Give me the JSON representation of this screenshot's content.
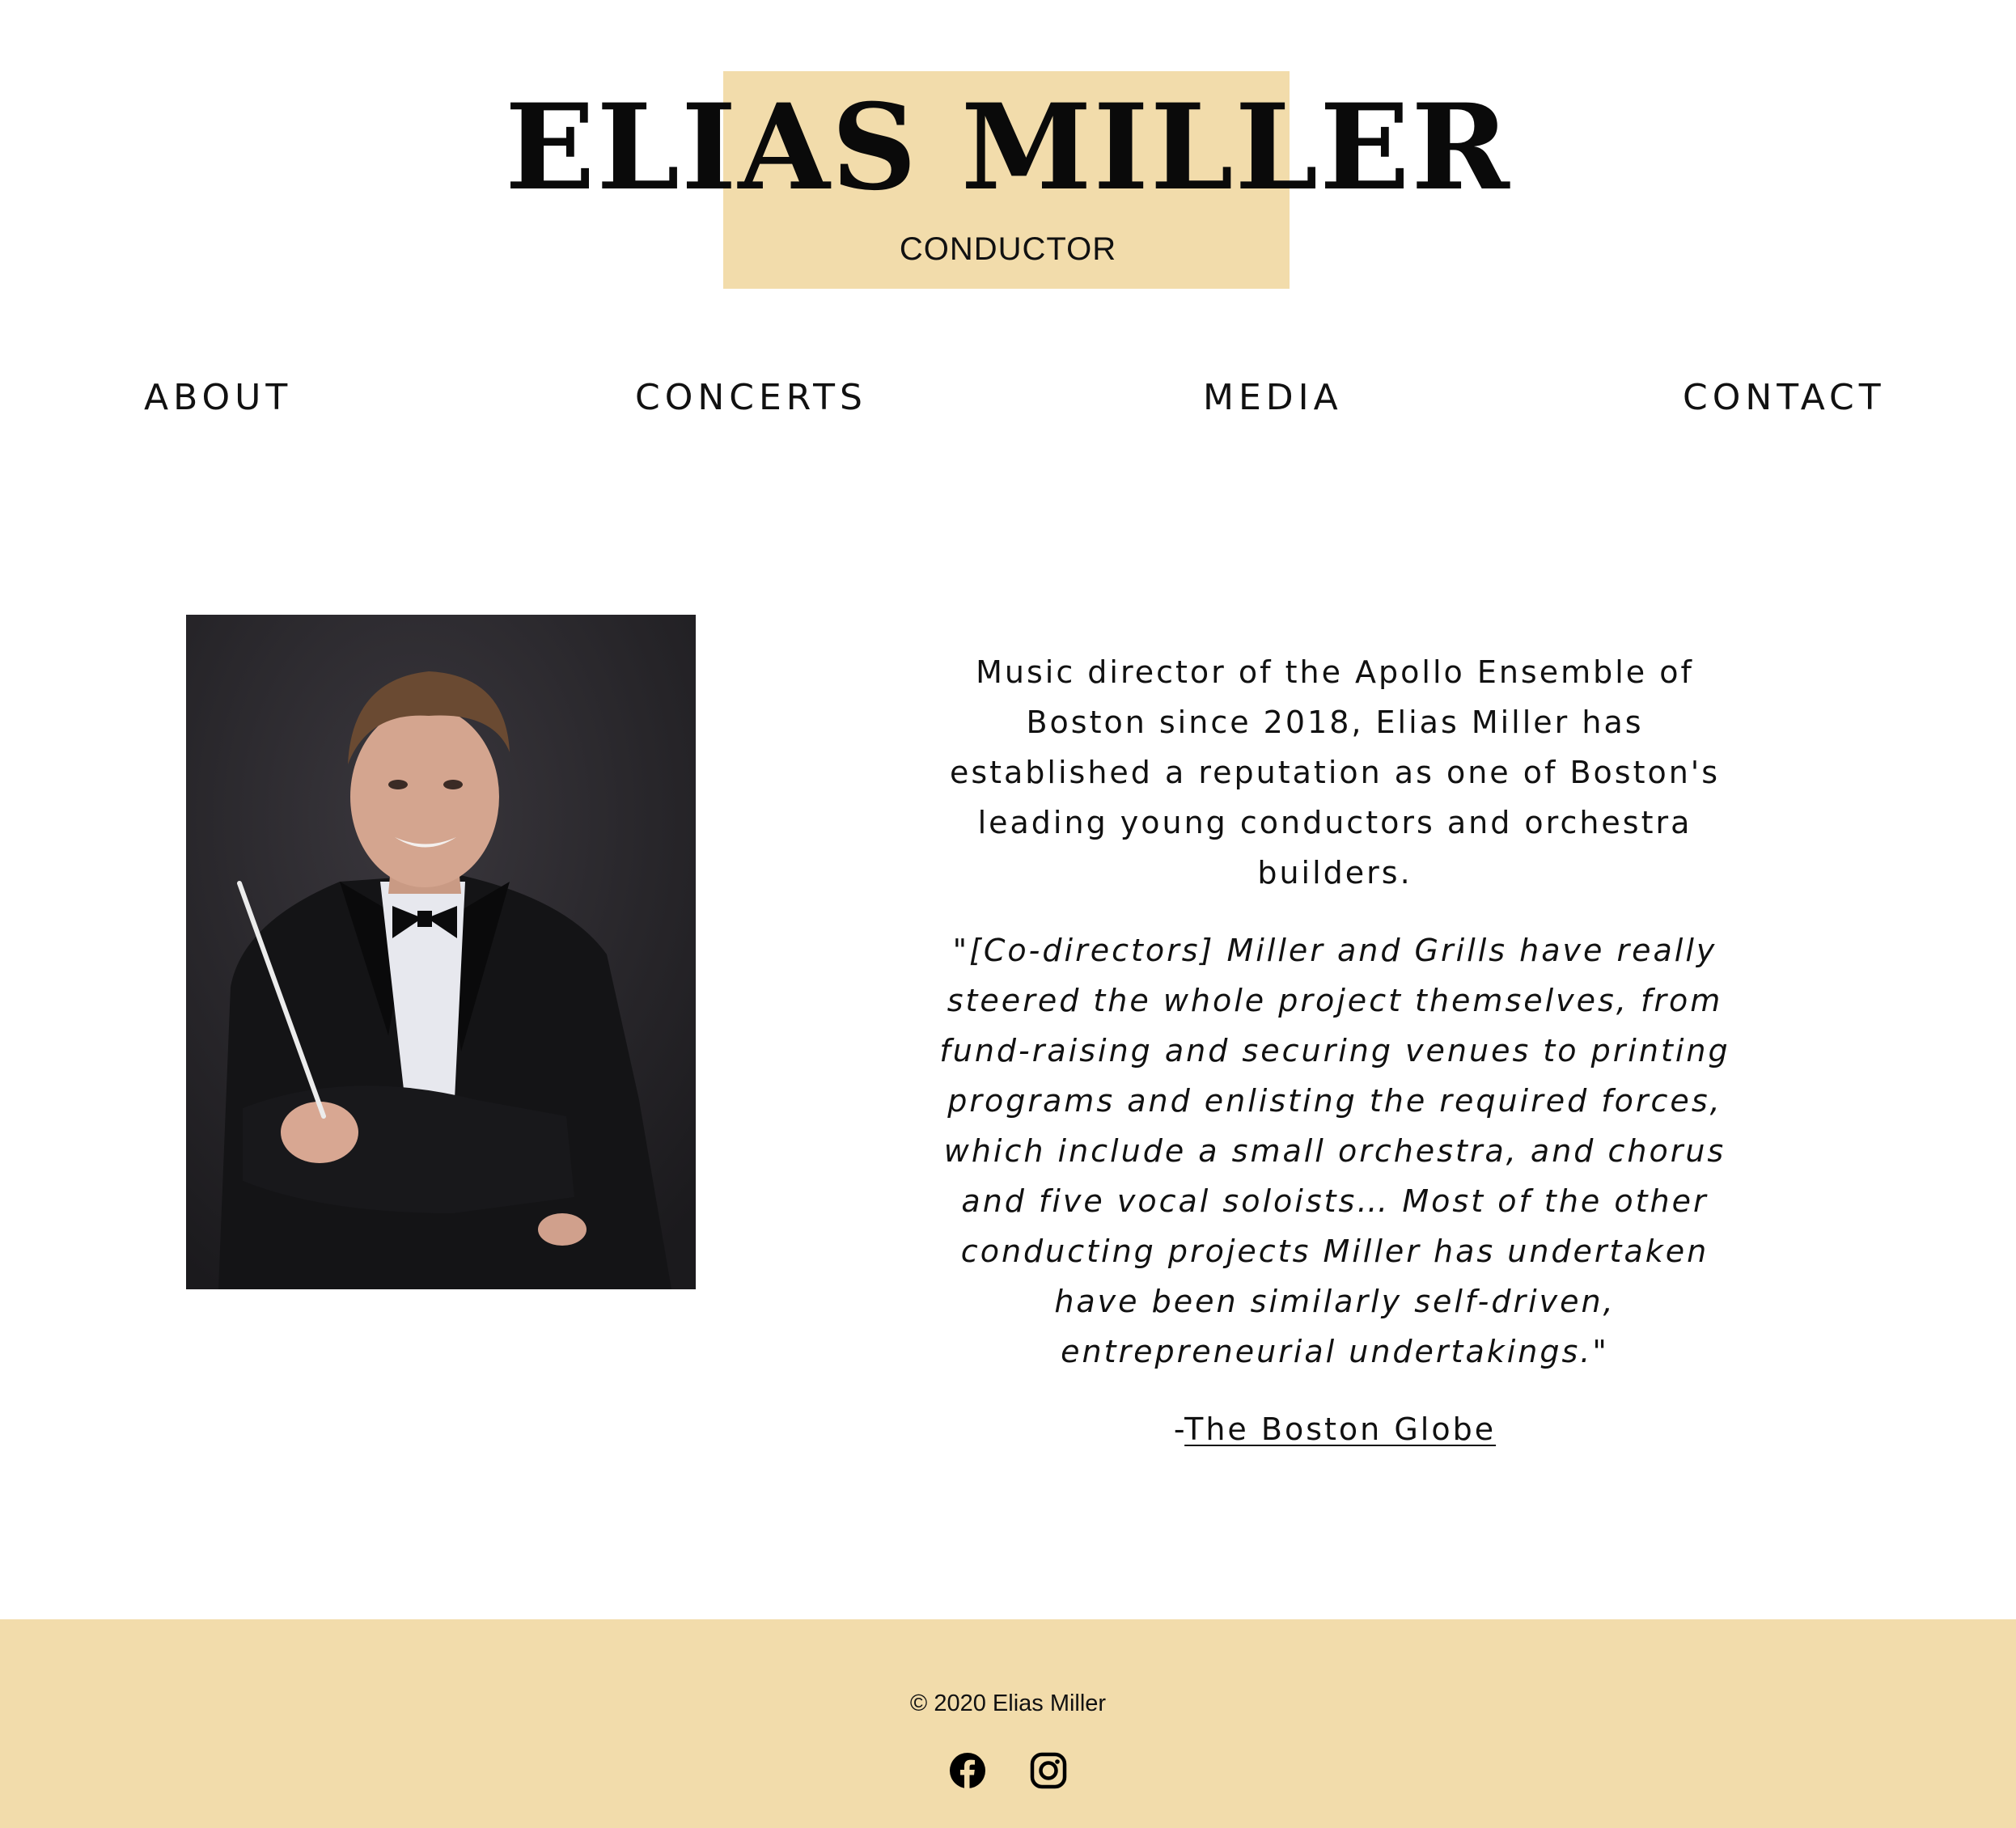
{
  "header": {
    "title": "ELIAS MILLER",
    "subtitle": "CONDUCTOR"
  },
  "nav": {
    "items": [
      {
        "label": "ABOUT"
      },
      {
        "label": "CONCERTS"
      },
      {
        "label": "MEDIA"
      },
      {
        "label": "CONTACT"
      }
    ]
  },
  "bio": {
    "intro": "Music director of the Apollo Ensemble of Boston since 2018, Elias Miller has established a reputation as one of Boston's leading young conductors and orchestra builders.",
    "quote": "\"[Co-directors] Miller and Grills have really steered the whole project themselves, from fund-raising and securing venues to printing programs and enlisting the required forces, which include a small orchestra, and chorus and five vocal soloists… Most of the other conducting projects Miller has undertaken have been similarly self-driven, entrepreneurial undertakings.\"",
    "source_prefix": "-",
    "source_link": "The Boston Globe"
  },
  "footer": {
    "copyright": "© 2020 Elias Miller",
    "social": [
      {
        "icon": "facebook-icon"
      },
      {
        "icon": "instagram-icon"
      }
    ]
  },
  "colors": {
    "accent": "#f2dcab",
    "text": "#111111",
    "background": "#ffffff"
  }
}
